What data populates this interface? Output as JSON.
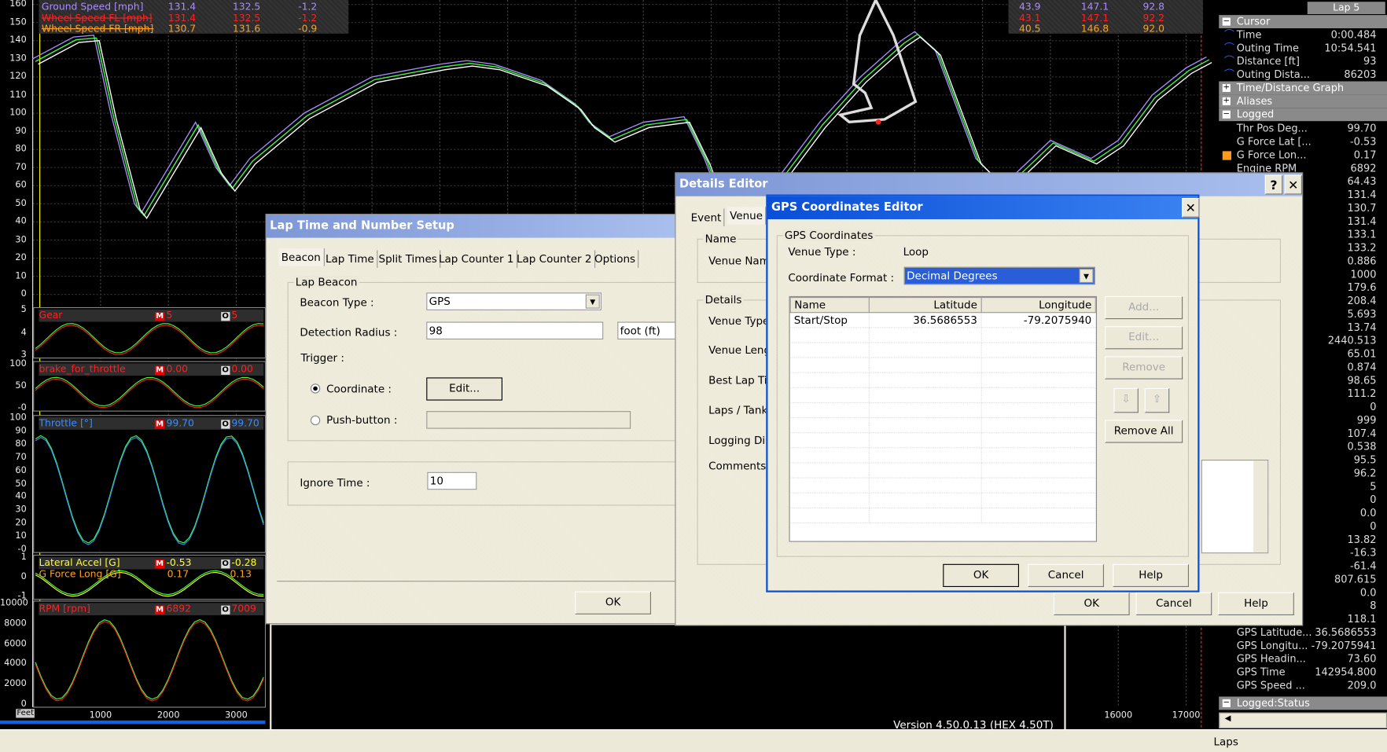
{
  "graph": {
    "speed_ticks": [
      "160",
      "150",
      "140",
      "130",
      "120",
      "110",
      "100",
      "90",
      "80",
      "70",
      "60",
      "50",
      "40",
      "30",
      "20",
      "10",
      "0"
    ],
    "distance_ticks_left": [
      "1000",
      "2000",
      "3000"
    ],
    "distance_ticks_right": [
      "16000",
      "17000"
    ],
    "distance_unit_badge": "Feet",
    "legend": [
      {
        "name": "Ground Speed [mph]",
        "v1": "131.4",
        "v2": "132.5",
        "v3": "-1.2",
        "r1": "43.9",
        "r2": "147.1",
        "r3": "92.8",
        "color": "#a98cff",
        "struck": false
      },
      {
        "name": "Wheel Speed FL [mph]",
        "v1": "131.4",
        "v2": "132.5",
        "v3": "-1.2",
        "r1": "43.1",
        "r2": "147.1",
        "r3": "92.2",
        "color": "#ff2020",
        "struck": true
      },
      {
        "name": "Wheel Speed FR [mph]",
        "v1": "130.7",
        "v2": "131.6",
        "v3": "-0.9",
        "r1": "40.5",
        "r2": "146.8",
        "r3": "92.0",
        "color": "#ffa020",
        "struck": true
      }
    ],
    "speed_curve": [
      [
        0,
        130
      ],
      [
        600,
        142
      ],
      [
        900,
        143
      ],
      [
        1150,
        100
      ],
      [
        1500,
        50
      ],
      [
        1600,
        45
      ],
      [
        2000,
        70
      ],
      [
        2400,
        95
      ],
      [
        2700,
        70
      ],
      [
        2900,
        60
      ],
      [
        3200,
        75
      ],
      [
        4000,
        100
      ],
      [
        5000,
        120
      ],
      [
        6000,
        127
      ],
      [
        6400,
        129
      ],
      [
        6800,
        127
      ],
      [
        7500,
        118
      ],
      [
        8000,
        105
      ],
      [
        8200,
        95
      ],
      [
        8500,
        87
      ],
      [
        9000,
        95
      ],
      [
        9600,
        98
      ],
      [
        9900,
        75
      ],
      [
        10100,
        55
      ],
      [
        10400,
        38
      ],
      [
        10600,
        35
      ],
      [
        11000,
        65
      ],
      [
        11600,
        95
      ],
      [
        12200,
        120
      ],
      [
        12800,
        140
      ],
      [
        13000,
        145
      ],
      [
        13300,
        135
      ],
      [
        13600,
        105
      ],
      [
        13900,
        75
      ],
      [
        14300,
        60
      ],
      [
        15000,
        85
      ],
      [
        15600,
        75
      ],
      [
        16000,
        85
      ],
      [
        16500,
        110
      ],
      [
        17000,
        125
      ],
      [
        17300,
        131
      ]
    ],
    "strips": [
      {
        "name": "Gear",
        "m": "5",
        "o": "5",
        "color": "#ff2020",
        "ticks": [
          "5",
          "4",
          "3"
        ]
      },
      {
        "name": "brake_for_throttle",
        "m": "0.00",
        "o": "0.00",
        "color": "#ff2020",
        "ticks": [
          "100",
          "50",
          "-0"
        ]
      },
      {
        "name": "Throttle [°]",
        "m": "99.70",
        "o": "99.70",
        "color": "#3a8cff",
        "ticks": [
          "100",
          "90",
          "80",
          "70",
          "60",
          "50",
          "40",
          "30",
          "20",
          "10",
          "-0"
        ]
      },
      {
        "name": "Lateral Accel [G]",
        "name2": "G Force Long [G]",
        "m": "-0.53",
        "o": "-0.28",
        "m2": "0.17",
        "o2": "0.13",
        "color": "#ffff30",
        "color2": "#ffa020",
        "ticks": [
          "1",
          "0",
          "-1"
        ]
      },
      {
        "name": "RPM [rpm]",
        "m": "6892",
        "o": "7009",
        "color": "#ff2020",
        "ticks": [
          "10000",
          "8000",
          "6000",
          "4000",
          "2000",
          "0"
        ]
      }
    ]
  },
  "panel": {
    "lap": "Lap 5",
    "cursor_header": "Cursor",
    "cursor": [
      {
        "name": "Time",
        "value": "0:00.484"
      },
      {
        "name": "Outing Time",
        "value": "10:54.541"
      },
      {
        "name": "Distance [ft]",
        "value": "93"
      },
      {
        "name": "Outing Dista...",
        "value": "86203"
      }
    ],
    "time_distance_header": "Time/Distance Graph",
    "aliases_header": "Aliases",
    "logged_header": "Logged",
    "logged": [
      {
        "name": "Thr Pos Deg...",
        "value": "99.70"
      },
      {
        "name": "G Force Lat [...",
        "value": "-0.53"
      },
      {
        "name": "G Force Lon...",
        "value": "0.17",
        "marker": "#ff9a1a"
      },
      {
        "name": "Engine RPM",
        "value": "6892"
      },
      {
        "value": "64.43"
      },
      {
        "value": "131.4"
      },
      {
        "value": "130.7"
      },
      {
        "value": "131.4"
      },
      {
        "value": "133.1"
      },
      {
        "value": "133.2"
      },
      {
        "value": "0.886"
      },
      {
        "value": "1000"
      },
      {
        "value": "179.6"
      },
      {
        "value": "208.4"
      },
      {
        "value": "5.693"
      },
      {
        "value": "13.74"
      },
      {
        "value": "2440.513"
      },
      {
        "value": "65.01"
      },
      {
        "value": "0.874"
      },
      {
        "value": "98.65"
      },
      {
        "value": "111.2"
      },
      {
        "value": "0"
      },
      {
        "value": "999"
      },
      {
        "value": "107.4"
      },
      {
        "value": "0.538"
      },
      {
        "value": "95.5"
      },
      {
        "value": "96.2"
      },
      {
        "value": "5"
      },
      {
        "value": "0"
      },
      {
        "value": "0.0"
      },
      {
        "value": "0"
      },
      {
        "value": "13.82"
      },
      {
        "value": "-16.3"
      },
      {
        "value": "-61.4"
      },
      {
        "value": "807.615"
      },
      {
        "value": "0.0"
      },
      {
        "value": "8"
      },
      {
        "value": "118.1"
      },
      {
        "name": "GPS Latitude...",
        "value": "36.5686553"
      },
      {
        "name": "GPS Longitu...",
        "value": "-79.2075941"
      },
      {
        "name": "GPS Headin...",
        "value": "73.60"
      },
      {
        "name": "GPS Time",
        "value": "142954.800"
      },
      {
        "name": "GPS Speed ...",
        "value": "209.0"
      }
    ],
    "status_header": "Logged:Status"
  },
  "lap_dialog": {
    "title": "Lap Time and Number Setup",
    "tabs": [
      "Beacon",
      "Lap Time",
      "Split Times",
      "Lap Counter 1",
      "Lap Counter 2",
      "Options"
    ],
    "group": "Lap Beacon",
    "beacon_type_label": "Beacon Type :",
    "beacon_type": "GPS",
    "radius_label": "Detection Radius :",
    "radius": "98",
    "radius_unit": "foot (ft)",
    "trigger_label": "Trigger :",
    "coord_label": "Coordinate :",
    "coord_selected": true,
    "edit_button": "Edit...",
    "push_label": "Push-button :",
    "ignore_label": "Ignore Time :",
    "ignore": "10",
    "ok": "OK"
  },
  "version": "Version 4.50.0.13   (HEX 4.50T)",
  "details_dialog": {
    "title": "Details Editor",
    "tabs": [
      "Event",
      "Venue"
    ],
    "name_group": "Name",
    "venue_name": "Venue Name",
    "details_group": "Details",
    "labels": [
      "Venue Type",
      "Venue Leng",
      "Best Lap Tim",
      "Laps / Tank",
      "Logging Dire",
      "Comments"
    ],
    "ok": "OK",
    "cancel": "Cancel",
    "help": "Help"
  },
  "gps_dialog": {
    "title": "GPS Coordinates Editor",
    "group": "GPS Coordinates",
    "venue_type_label": "Venue Type :",
    "venue_type": "Loop",
    "format_label": "Coordinate Format :",
    "format": "Decimal Degrees",
    "columns": [
      "Name",
      "Latitude",
      "Longitude"
    ],
    "rows": [
      [
        "Start/Stop",
        "36.5686553",
        "-79.2075940"
      ]
    ],
    "add": "Add...",
    "edit": "Edit...",
    "remove": "Remove",
    "down": "⇩",
    "up": "⇧",
    "remove_all": "Remove All",
    "ok": "OK",
    "cancel": "Cancel",
    "help": "Help"
  },
  "statusbar": {
    "laps": "Laps"
  }
}
